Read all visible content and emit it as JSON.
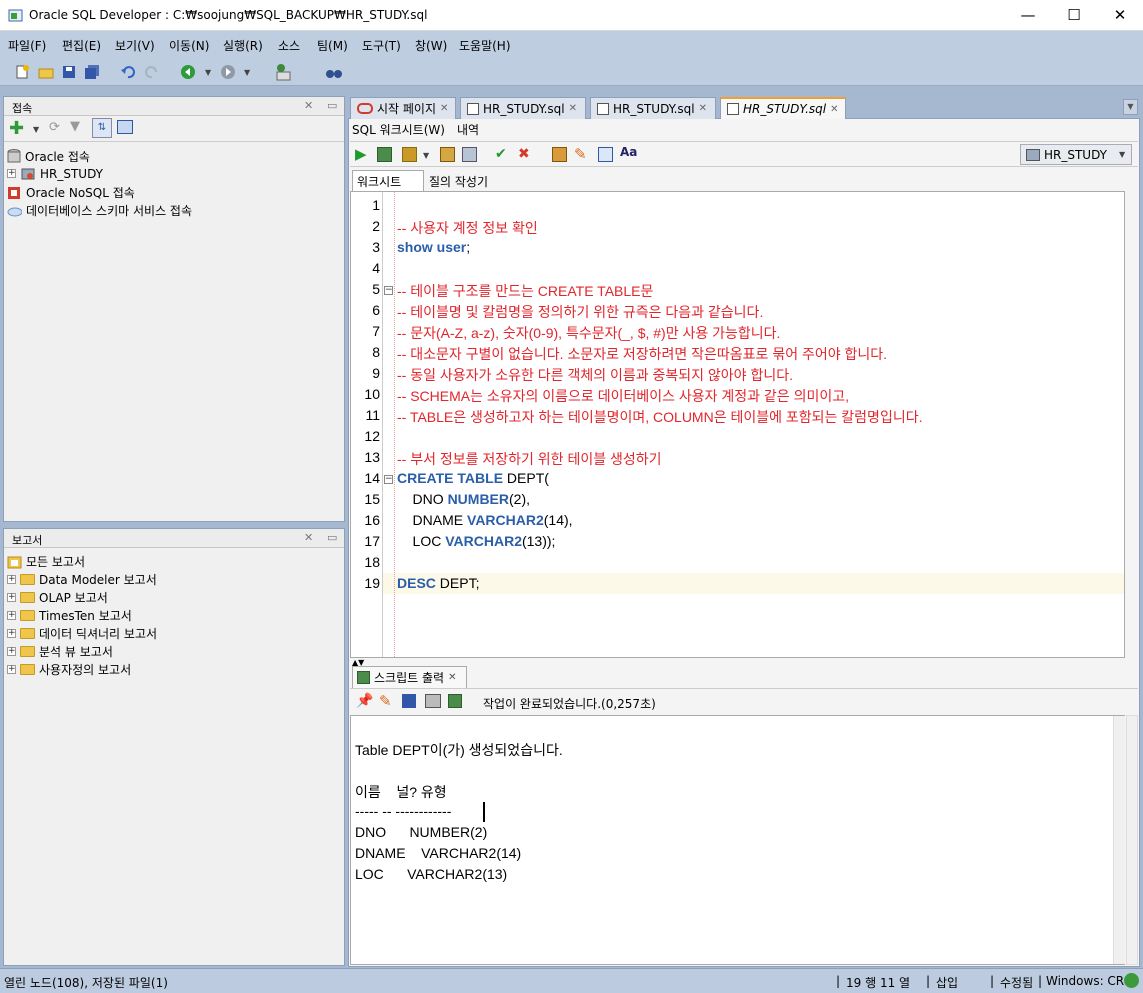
{
  "window": {
    "title": "Oracle SQL Developer : C:₩soojung₩SQL_BACKUP₩HR_STUDY.sql",
    "min": "—",
    "max": "☐",
    "close": "✕"
  },
  "menu": [
    "파일(F)",
    "편집(E)",
    "보기(V)",
    "이동(N)",
    "실행(R)",
    "소스",
    "팀(M)",
    "도구(T)",
    "창(W)",
    "도움말(H)"
  ],
  "connections": {
    "title": "접속",
    "items": [
      "Oracle 접속",
      "HR_STUDY",
      "Oracle NoSQL 접속",
      "데이터베이스 스키마 서비스 접속"
    ]
  },
  "reports": {
    "title": "보고서",
    "items": [
      "모든 보고서",
      "Data Modeler 보고서",
      "OLAP 보고서",
      "TimesTen 보고서",
      "데이터 딕셔너리 보고서",
      "분석 뷰 보고서",
      "사용자정의 보고서"
    ]
  },
  "tabs": [
    "시작 페이지",
    "HR_STUDY.sql",
    "HR_STUDY.sql",
    "HR_STUDY.sql"
  ],
  "subtabs": {
    "worksheet": "SQL 워크시트(W)",
    "history": "내역"
  },
  "connection_select": "HR_STUDY",
  "editor_tabs": {
    "worksheet": "워크시트",
    "query_builder": "질의 작성기"
  },
  "code_lines": [
    [],
    [
      {
        "t": "-- 사용자 계정 정보 확인",
        "c": "cmt"
      }
    ],
    [
      {
        "t": "show user",
        "c": "kw"
      },
      {
        "t": ";",
        "c": ""
      }
    ],
    [],
    [
      {
        "t": "-- 테이블 구조를 만드는 CREATE TABLE문",
        "c": "cmt"
      }
    ],
    [
      {
        "t": "-- 테이블명 및 칼럼명을 정의하기 위한 규즉은 다음과 같습니다.",
        "c": "cmt"
      }
    ],
    [
      {
        "t": "-- 문자(A-Z, a-z), 숫자(0-9), 특수문자(_, $, #)만 사용 가능합니다.",
        "c": "cmt"
      }
    ],
    [
      {
        "t": "-- 대소문자 구별이 없습니다. 소문자로 저장하려면 작은따옴표로 묶어 주어야 합니다.",
        "c": "cmt"
      }
    ],
    [
      {
        "t": "-- 동일 사용자가 소유한 다른 객체의 이름과 중복되지 않아야 합니다.",
        "c": "cmt"
      }
    ],
    [
      {
        "t": "-- SCHEMA는 소유자의 이름으로 데이터베이스 사용자 계정과 같은 의미이고,",
        "c": "cmt"
      }
    ],
    [
      {
        "t": "-- TABLE은 생성하고자 하는 테이블명이며, COLUMN은 테이블에 포함되는 칼럼명입니다.",
        "c": "cmt"
      }
    ],
    [],
    [
      {
        "t": "-- 부서 정보를 저장하기 위한 테이블 생성하기",
        "c": "cmt"
      }
    ],
    [
      {
        "t": "CREATE TABLE",
        "c": "kw"
      },
      {
        "t": " DEPT(",
        "c": ""
      }
    ],
    [
      {
        "t": "    DNO ",
        "c": ""
      },
      {
        "t": "NUMBER",
        "c": "kw"
      },
      {
        "t": "(2),",
        "c": ""
      }
    ],
    [
      {
        "t": "    DNAME ",
        "c": ""
      },
      {
        "t": "VARCHAR2",
        "c": "kw"
      },
      {
        "t": "(14),",
        "c": ""
      }
    ],
    [
      {
        "t": "    LOC ",
        "c": ""
      },
      {
        "t": "VARCHAR2",
        "c": "kw"
      },
      {
        "t": "(13));",
        "c": ""
      }
    ],
    [],
    [
      {
        "t": "DESC",
        "c": "kw"
      },
      {
        "t": " DEPT;",
        "c": ""
      }
    ]
  ],
  "script_output": {
    "tab": "스크립트 출력",
    "status": "작업이 완료되었습니다.(0,257초)",
    "lines": [
      "Table DEPT이(가) 생성되었습니다.",
      "",
      "이름    널? 유형",
      "----- -- ------------",
      "DNO      NUMBER(2)",
      "DNAME    VARCHAR2(14)",
      "LOC      VARCHAR2(13)"
    ]
  },
  "status": {
    "left": "열린 노드(108), 저장된 파일(1)",
    "pos": "19 행 11 열",
    "mode": "삽입",
    "modified": "수정됨",
    "platform": "Windows: CR"
  }
}
